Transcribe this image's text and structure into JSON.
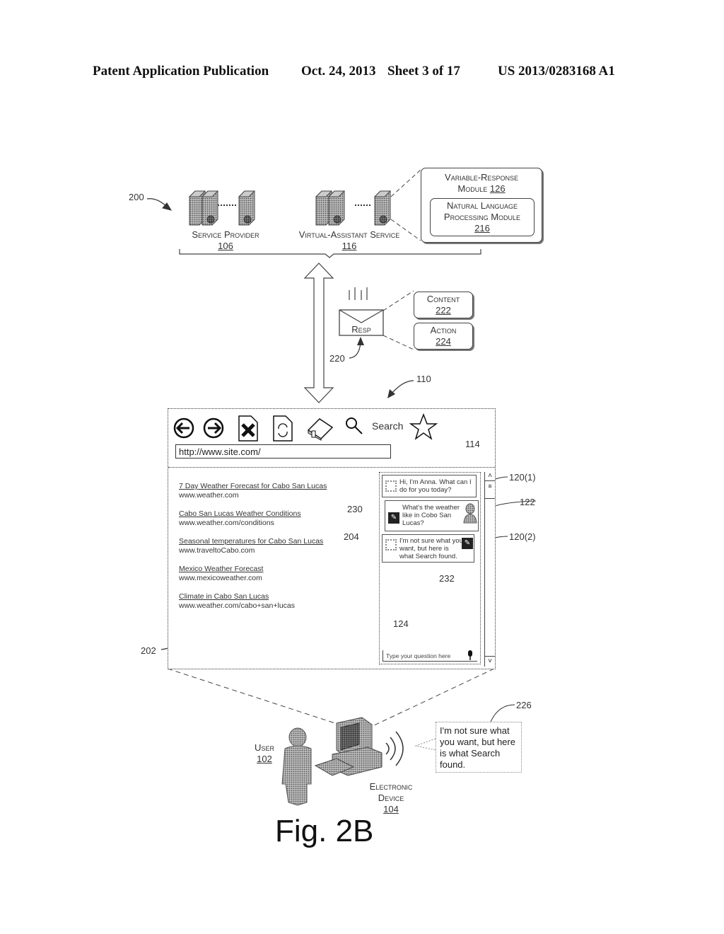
{
  "header": {
    "publication": "Patent Application Publication",
    "date": "Oct. 24, 2013",
    "sheet": "Sheet 3 of 17",
    "number": "US 2013/0283168 A1"
  },
  "refs": {
    "system": "200",
    "resp_ref": "220",
    "device_ref": "110",
    "chat_ref": "114",
    "bubble1_ref": "120(1)",
    "user_bubble_ref": "122",
    "bubble2_ref": "120(2)",
    "edit_ref_230": "230",
    "avatar_ref_204": "204",
    "edit_ref_232": "232",
    "input_ref": "124",
    "results_ref": "202",
    "speech_ref": "226"
  },
  "servers": {
    "service_provider": {
      "label": "Service Provider",
      "number": "106"
    },
    "virtual_assistant": {
      "label": "Virtual-Assistant Service",
      "number": "116"
    }
  },
  "modules": {
    "variable_response": {
      "label": "Variable-Response",
      "label2": "Module",
      "number": "126"
    },
    "nlp": {
      "label": "Natural Language",
      "label2": "Processing Module",
      "number": "216"
    }
  },
  "response": {
    "envelope_label": "Resp",
    "content": {
      "label": "Content",
      "number": "222"
    },
    "action": {
      "label": "Action",
      "number": "224"
    }
  },
  "browser": {
    "toolbar": {
      "search_label": "Search",
      "icons": [
        "back-arrow-icon",
        "forward-arrow-icon",
        "stop-document-icon",
        "refresh-document-icon",
        "home-icon",
        "search-icon",
        "favorite-star-icon"
      ]
    },
    "url": "http://www.site.com/",
    "results": [
      {
        "title": "7 Day Weather Forecast for Cabo San Lucas",
        "link": "www.weather.com"
      },
      {
        "title": "Cabo San Lucas Weather Conditions",
        "link": "www.weather.com/conditions"
      },
      {
        "title": "Seasonal temperatures for  Cabo San Lucas",
        "link": "www.traveltoCabo.com"
      },
      {
        "title": "Mexico Weather Forecast",
        "link": "www.mexicoweather.com"
      },
      {
        "title": "Climate in Cabo San Lucas",
        "link": "www.weather.com/cabo+san+lucas"
      }
    ],
    "chat": {
      "bubble1": "Hi, I'm Anna.  What can I do for you today?",
      "user_bubble": "What's the weather like in Cobo San Lucas?",
      "bubble2": "I'm not sure what you want, but here is what Search found.",
      "input_placeholder": "Type your question here"
    }
  },
  "bottom": {
    "user": {
      "label": "User",
      "number": "102"
    },
    "device": {
      "label": "Electronic",
      "label2": "Device",
      "number": "104"
    },
    "speech": "I'm not sure what you want, but here is what Search found."
  },
  "figure_label": "Fig. 2B"
}
